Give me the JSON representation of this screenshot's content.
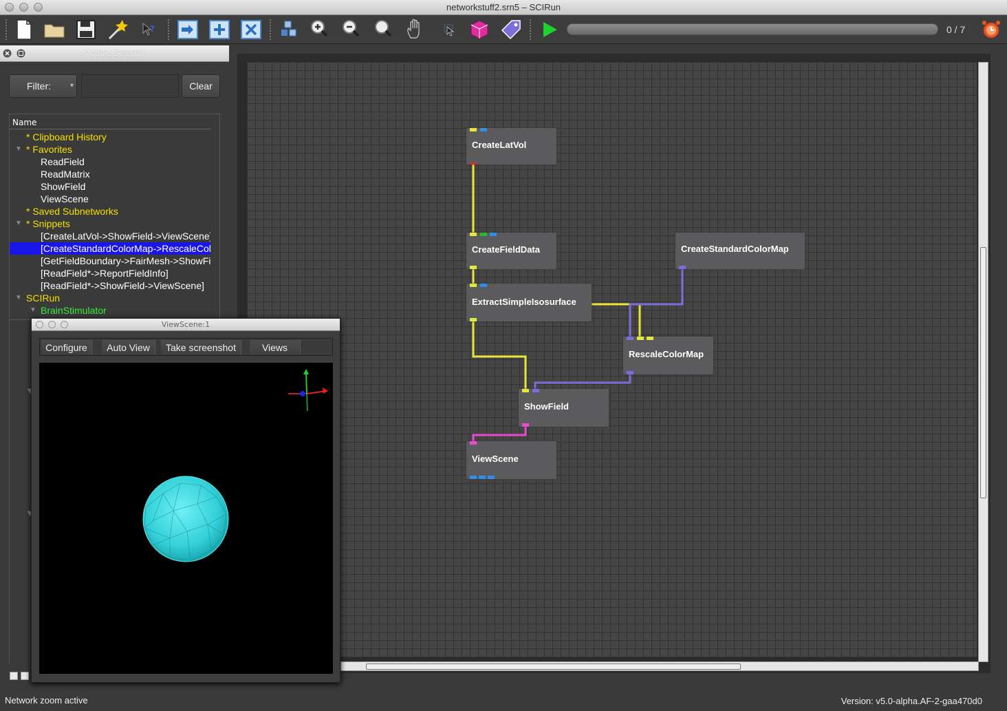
{
  "window": {
    "title": "networkstuff2.srn5 – SCIRun"
  },
  "toolbar": {
    "icons": [
      "new-file",
      "open-folder",
      "save",
      "magic-wand",
      "whats-this",
      "import",
      "add",
      "delete",
      "layout",
      "zoom-in",
      "zoom-out",
      "zoom-best",
      "pan-hand",
      "select",
      "cube",
      "tag",
      "run",
      "timer"
    ],
    "progress_fraction": 0,
    "progress_text": "0 / 7"
  },
  "module_selector": {
    "title": "Module Selector",
    "filter_label": "Filter:",
    "filter_value": "",
    "clear_label": "Clear",
    "column_header": "Name",
    "items": [
      {
        "label": "* Clipboard History",
        "color": "#f5e000"
      },
      {
        "label": "* Favorites",
        "color": "#f5e000"
      },
      {
        "label": "ReadField",
        "color": "#ffffff"
      },
      {
        "label": "ReadMatrix",
        "color": "#ffffff"
      },
      {
        "label": "ShowField",
        "color": "#ffffff"
      },
      {
        "label": "ViewScene",
        "color": "#ffffff"
      },
      {
        "label": "* Saved Subnetworks",
        "color": "#f5e000"
      },
      {
        "label": "* Snippets",
        "color": "#f5e000"
      },
      {
        "label": "[CreateLatVol->ShowField->ViewScene]",
        "color": "#ffffff"
      },
      {
        "label": "[CreateStandardColorMap->RescaleColorMap]",
        "color": "#ffffff"
      },
      {
        "label": "[GetFieldBoundary->FairMesh->ShowField]",
        "color": "#ffffff"
      },
      {
        "label": "[ReadField*->ReportFieldInfo]",
        "color": "#ffffff"
      },
      {
        "label": "[ReadField*->ShowField->ViewScene]",
        "color": "#ffffff"
      },
      {
        "label": "SCIRun",
        "color": "#f5e000"
      },
      {
        "label": "BrainStimulator",
        "color": "#3dea3d"
      }
    ]
  },
  "network": {
    "modules": [
      {
        "name": "CreateLatVol"
      },
      {
        "name": "CreateFieldData"
      },
      {
        "name": "ExtractSimpleIsosurface"
      },
      {
        "name": "CreateStandardColorMap"
      },
      {
        "name": "RescaleColorMap"
      },
      {
        "name": "ShowField"
      },
      {
        "name": "ViewScene"
      }
    ],
    "colors": {
      "field": "#e6e63c",
      "colormap": "#7a6fd8",
      "geometry": "#e84cd0",
      "matrix": "#2f8fe8",
      "scalar": "#2eb82e",
      "error": "#d03030"
    }
  },
  "viewscene": {
    "title": "ViewScene:1",
    "buttons": [
      "Configure",
      "Auto View",
      "Take screenshot",
      "Views"
    ],
    "sphere_color": "#34d0d8"
  },
  "status": {
    "left": "Network zoom active",
    "right": "Version: v5.0-alpha.AF-2-gaa470d0"
  }
}
